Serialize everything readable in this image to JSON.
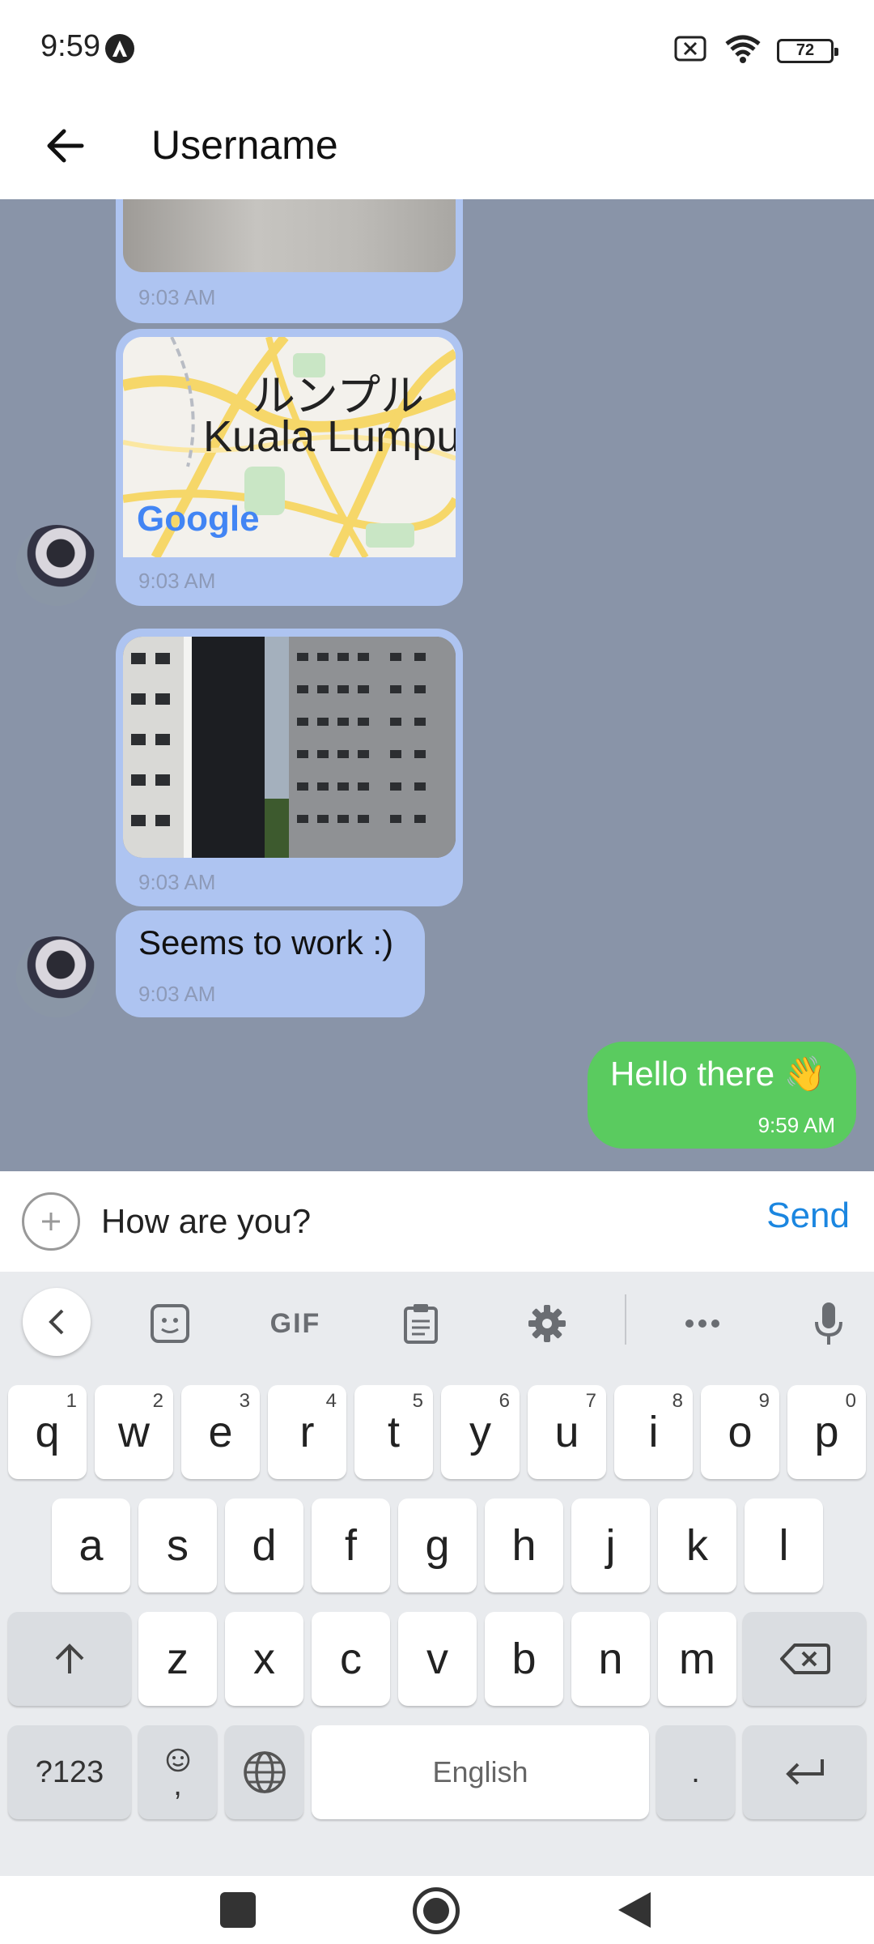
{
  "status_bar": {
    "time": "9:59",
    "battery": "72"
  },
  "app_bar": {
    "title": "Username"
  },
  "messages": [
    {
      "type": "image",
      "direction": "incoming",
      "time": "9:03 AM"
    },
    {
      "type": "map",
      "direction": "incoming",
      "time": "9:03 AM",
      "map_text_top": "ルンプル",
      "map_text_city": "Kuala Lumpu",
      "map_brand": "Google"
    },
    {
      "type": "image",
      "direction": "incoming",
      "time": "9:03 AM"
    },
    {
      "type": "text",
      "direction": "incoming",
      "text": "Seems to work :)",
      "time": "9:03 AM"
    },
    {
      "type": "text",
      "direction": "outgoing",
      "text": "Hello there 👋",
      "time": "9:59 AM"
    }
  ],
  "composer": {
    "value": "How are you?",
    "send_label": "Send"
  },
  "keyboard": {
    "toolbar": {
      "gif_label": "GIF"
    },
    "row1": [
      {
        "k": "q",
        "h": "1"
      },
      {
        "k": "w",
        "h": "2"
      },
      {
        "k": "e",
        "h": "3"
      },
      {
        "k": "r",
        "h": "4"
      },
      {
        "k": "t",
        "h": "5"
      },
      {
        "k": "y",
        "h": "6"
      },
      {
        "k": "u",
        "h": "7"
      },
      {
        "k": "i",
        "h": "8"
      },
      {
        "k": "o",
        "h": "9"
      },
      {
        "k": "p",
        "h": "0"
      }
    ],
    "row2": [
      "a",
      "s",
      "d",
      "f",
      "g",
      "h",
      "j",
      "k",
      "l"
    ],
    "row3": [
      "z",
      "x",
      "c",
      "v",
      "b",
      "n",
      "m"
    ],
    "symbols_label": "?123",
    "comma_label": ",",
    "space_label": "English",
    "period_label": "."
  },
  "colors": {
    "chat_bg": "#8994a8",
    "incoming_bubble": "#aec4f1",
    "outgoing_bubble": "#5acb5f",
    "send": "#1b86e0"
  }
}
